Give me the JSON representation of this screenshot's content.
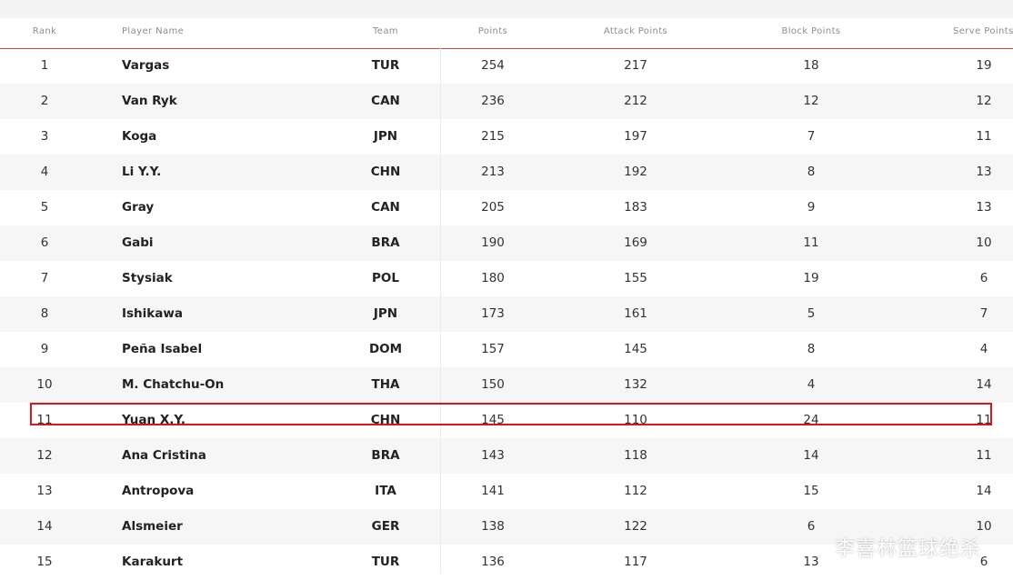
{
  "table": {
    "headers": {
      "rank": "Rank",
      "player_name": "Player Name",
      "team": "Team",
      "points": "Points",
      "attack_points": "Attack Points",
      "block_points": "Block Points",
      "serve_points": "Serve Points"
    },
    "rows": [
      {
        "rank": "1",
        "name": "Vargas",
        "team": "TUR",
        "points": "254",
        "attack": "217",
        "block": "18",
        "serve": "19"
      },
      {
        "rank": "2",
        "name": "Van Ryk",
        "team": "CAN",
        "points": "236",
        "attack": "212",
        "block": "12",
        "serve": "12"
      },
      {
        "rank": "3",
        "name": "Koga",
        "team": "JPN",
        "points": "215",
        "attack": "197",
        "block": "7",
        "serve": "11"
      },
      {
        "rank": "4",
        "name": "Li Y.Y.",
        "team": "CHN",
        "points": "213",
        "attack": "192",
        "block": "8",
        "serve": "13"
      },
      {
        "rank": "5",
        "name": "Gray",
        "team": "CAN",
        "points": "205",
        "attack": "183",
        "block": "9",
        "serve": "13"
      },
      {
        "rank": "6",
        "name": "Gabi",
        "team": "BRA",
        "points": "190",
        "attack": "169",
        "block": "11",
        "serve": "10"
      },
      {
        "rank": "7",
        "name": "Stysiak",
        "team": "POL",
        "points": "180",
        "attack": "155",
        "block": "19",
        "serve": "6"
      },
      {
        "rank": "8",
        "name": "Ishikawa",
        "team": "JPN",
        "points": "173",
        "attack": "161",
        "block": "5",
        "serve": "7"
      },
      {
        "rank": "9",
        "name": "Peña Isabel",
        "team": "DOM",
        "points": "157",
        "attack": "145",
        "block": "8",
        "serve": "4"
      },
      {
        "rank": "10",
        "name": "M. Chatchu-On",
        "team": "THA",
        "points": "150",
        "attack": "132",
        "block": "4",
        "serve": "14"
      },
      {
        "rank": "11",
        "name": "Yuan X.Y.",
        "team": "CHN",
        "points": "145",
        "attack": "110",
        "block": "24",
        "serve": "11"
      },
      {
        "rank": "12",
        "name": "Ana Cristina",
        "team": "BRA",
        "points": "143",
        "attack": "118",
        "block": "14",
        "serve": "11"
      },
      {
        "rank": "13",
        "name": "Antropova",
        "team": "ITA",
        "points": "141",
        "attack": "112",
        "block": "15",
        "serve": "14"
      },
      {
        "rank": "14",
        "name": "Alsmeier",
        "team": "GER",
        "points": "138",
        "attack": "122",
        "block": "6",
        "serve": "10"
      },
      {
        "rank": "15",
        "name": "Karakurt",
        "team": "TUR",
        "points": "136",
        "attack": "117",
        "block": "13",
        "serve": "6"
      }
    ]
  },
  "highlight": {
    "color": "#d9161c"
  },
  "accent_color": "#d6453e",
  "watermark": "李喜林篮球绝杀"
}
